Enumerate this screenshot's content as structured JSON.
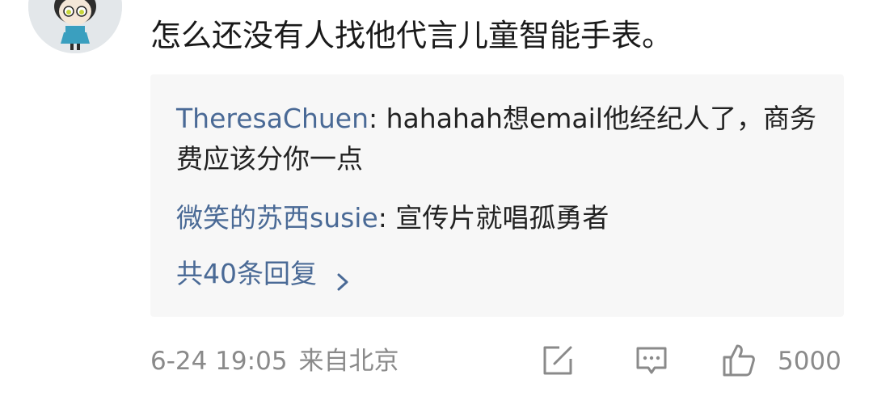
{
  "comment": {
    "text": "怎么还没有人找他代言儿童智能手表。"
  },
  "replies": [
    {
      "author": "TheresaChuen",
      "separator": ": ",
      "text": "hahahah想email他经纪人了，商务费应该分你一点"
    },
    {
      "author": "微笑的苏西susie",
      "separator": ": ",
      "text": "宣传片就唱孤勇者"
    }
  ],
  "more_replies": {
    "label": "共40条回复",
    "icon": "chevron-right-icon"
  },
  "footer": {
    "date": "6-24 19:05",
    "location": "来自北京",
    "like_count": "5000",
    "icons": [
      "share-icon",
      "comment-icon",
      "thumbs-up-icon"
    ]
  },
  "colors": {
    "link": "#4a6a96",
    "meta": "#8a8a8a",
    "box_bg": "#f7f7f7",
    "text": "#1a1a1a"
  }
}
